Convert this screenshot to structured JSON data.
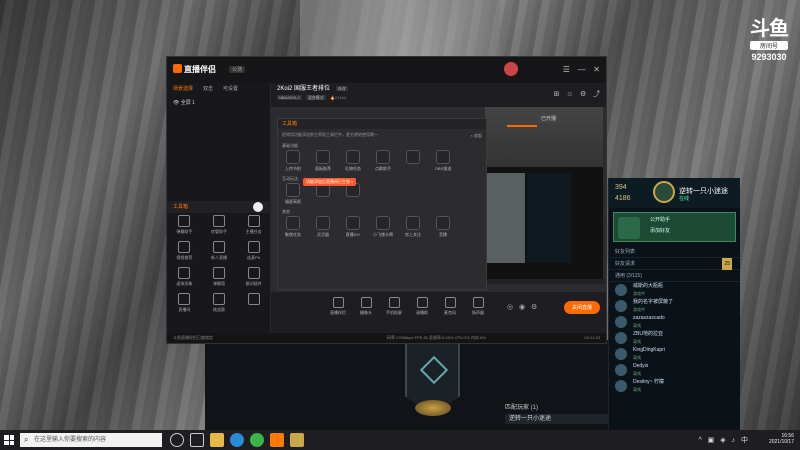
{
  "douyu": {
    "logo": "斗鱼",
    "sub": "房间号",
    "room": "9293030"
  },
  "app": {
    "brand": "直播伴侣",
    "version": "公测",
    "left_tabs": [
      "场景选择",
      "双击",
      "可设置"
    ],
    "scene": "全屏 1",
    "tools_header": "工具箱",
    "tools": [
      {
        "label": "弹幕助手"
      },
      {
        "label": "房管助手"
      },
      {
        "label": "主播任务"
      },
      {
        "label": "视频推荐"
      },
      {
        "label": "新人直播"
      },
      {
        "label": "连麦PK"
      },
      {
        "label": "虚拟形象"
      },
      {
        "label": "弹幕墙"
      },
      {
        "label": "歌词插件"
      },
      {
        "label": "直播间"
      },
      {
        "label": "挑战赛"
      },
      {
        "label": ""
      }
    ],
    "status_left": "斗鱼直播伴侣已被锁定",
    "status_right": "码率:1790kbps   FPS:30   丢帧率:0.00%   CPU:2%   内存:6%",
    "time": "02:21:23",
    "stream_title": "2Koi2 国服王者排位",
    "edit_label": "修改",
    "stream_sub": [
      "NBA2KOL2",
      "混合模式"
    ],
    "viewers": "21444",
    "online_label": "已开播",
    "toolbox": {
      "header": "工具箱",
      "desc": "把常用功能添加到主界面工具栏中，更方便地使用哦～",
      "close": "× 收起",
      "tooltip": "功能添加后直播间已生效 ×",
      "sect1": "基础功能",
      "row1": [
        "上传节拍",
        "面板推荐",
        "礼物任务",
        "点歌助手",
        "",
        "OBS推流"
      ],
      "sect2": "互动玩法",
      "row2": [
        "福星高照",
        "",
        ""
      ],
      "sect3": "其他",
      "row3": [
        "聚焦任务",
        "灵活器",
        "直播DIY",
        "小飞猪卡牌",
        "房上关注",
        "音播"
      ]
    },
    "controls": [
      "直播伴侣",
      "摄像头",
      "手机投屏",
      "录播助",
      "麦克风",
      "扬声器"
    ],
    "go_live": "关闭直播"
  },
  "lol": {
    "stat1": "394",
    "stat2": "4186",
    "username": "逆转一只小迷途",
    "usub": "在线",
    "card_title": "公开助手",
    "card_sub": "添加好友",
    "tabs_label": "好友列表",
    "rank_label": "好友请求",
    "count": "25",
    "group_label": "通用 (3/115)",
    "friends": [
      {
        "name": "威斯的大瓶瓶",
        "status": "游戏中"
      },
      {
        "name": "我的名字被屏蔽了",
        "status": "游戏中"
      },
      {
        "name": "zazaszascado",
        "status": "离线"
      },
      {
        "name": "ZBU地的拉亚",
        "status": "离线"
      },
      {
        "name": "KingDingKapri",
        "status": "离线"
      },
      {
        "name": "Dedyis",
        "status": "离线"
      },
      {
        "name": "Destiny~ 柠檬",
        "status": "离线"
      }
    ]
  },
  "game": {
    "chat_label": "逆转一只小迷途",
    "queue": "匹配玩家 (1)"
  },
  "taskbar": {
    "search_placeholder": "在这里输入你要搜索的内容",
    "time": "16:56",
    "date": "2021/10/17"
  }
}
